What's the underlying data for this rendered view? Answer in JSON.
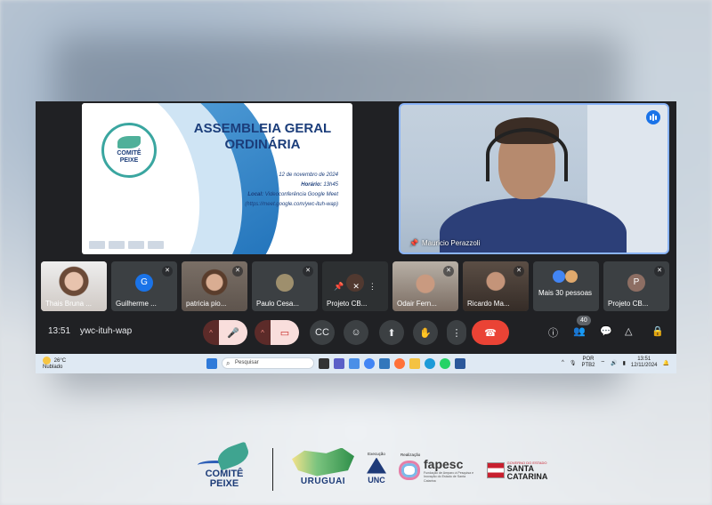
{
  "slide": {
    "title_line1": "ASSEMBLEIA GERAL",
    "title_line2": "ORDINÁRIA",
    "date": "12 de novembro de 2024",
    "time_label": "Horário:",
    "time_value": "13h45",
    "location_label": "Local:",
    "location_value": "Videoconferência Google Meet",
    "link": "(https://meet.google.com/ywc-ituh-wap)",
    "logo_line1": "COMITÊ",
    "logo_line2": "PEIXE"
  },
  "speaker": {
    "name": "Mauricio Perazzoli"
  },
  "participants": [
    {
      "name": "Thais Bruna ..."
    },
    {
      "name": "Guilherme ...",
      "initial": "G",
      "color": "#1a73e8"
    },
    {
      "name": "patricia pio..."
    },
    {
      "name": "Paulo Cesa..."
    },
    {
      "name": "Projeto CB..."
    },
    {
      "name": "Odair Fern..."
    },
    {
      "name": "Ricardo Ma..."
    },
    {
      "name": "Mais 30 pessoas"
    },
    {
      "name": "Projeto CB...",
      "initial": "P",
      "color": "#8d6e63"
    }
  ],
  "controls": {
    "clock": "13:51",
    "meeting_code": "ywc-ituh-wap",
    "participant_count": "40"
  },
  "taskbar": {
    "temperature": "26°C",
    "weather": "Nublado",
    "search_placeholder": "Pesquisar",
    "lang1": "POR",
    "lang2": "PTB2",
    "time": "13:51",
    "date": "12/11/2024"
  },
  "footer": {
    "comite_line1": "COMITÊ",
    "comite_line2": "PEIXE",
    "uruguai": "URUGUAI",
    "execucao": "Execução",
    "unc": "UNC",
    "realizacao": "Realização",
    "fapesc": "fapesc",
    "fapesc_sub": "Fundação de Amparo à Pesquisa e Inovação do Estado de Santa Catarina",
    "gov": "GOVERNO DO ESTADO",
    "santa": "SANTA",
    "catarina": "CATARINA"
  }
}
